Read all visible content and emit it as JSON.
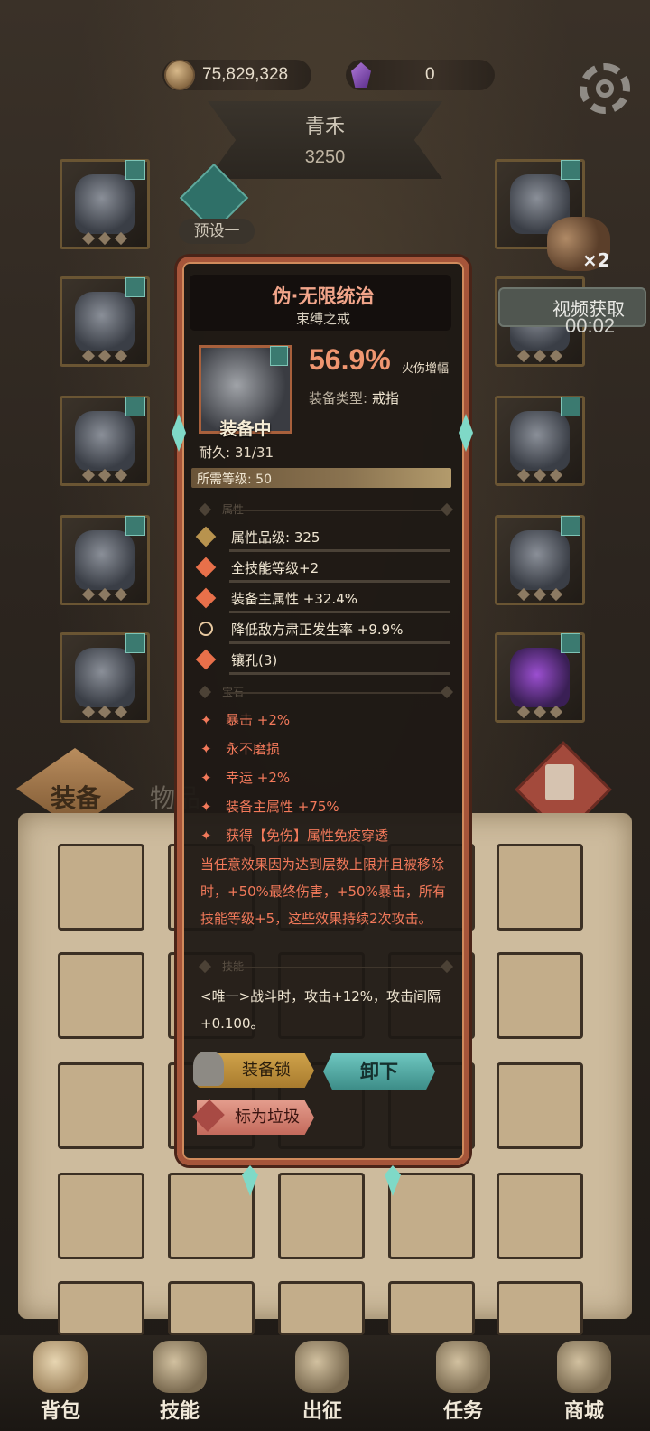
{
  "currency": {
    "coins": "75,829,328",
    "gems": "0"
  },
  "hero": {
    "name": "青禾",
    "power": "3250"
  },
  "preset": {
    "label": "预设一"
  },
  "reward": {
    "multiplier": "×2",
    "video_label": "视频获取",
    "timer": "00:02"
  },
  "tabs": {
    "equip": "装备",
    "items": "物品"
  },
  "tooltip": {
    "name": "伪·无限统治",
    "subtitle": "束缚之戒",
    "equipped_label": "装备中",
    "main_value": "56.9%",
    "main_value_label": "火伤增幅",
    "type_label": "装备类型:",
    "type_value": "戒指",
    "durability": "耐久: 31/31",
    "required_level": "所需等级: 50",
    "section_attributes": "属性",
    "attributes": [
      "属性品级: 325",
      "全技能等级+2",
      "装备主属性 +32.4%",
      "降低敌方肃正发生率 +9.9%",
      "镶孔(3)"
    ],
    "section_gems": "宝石",
    "gem_bonuses": [
      "暴击 +2%",
      "永不磨损",
      "幸运 +2%",
      "装备主属性 +75%",
      "获得【免伤】属性免疫穿透"
    ],
    "effect_text": "当任意效果因为达到层数上限并且被移除时，+50%最终伤害，+50%暴击，所有技能等级+5，这些效果持续2次攻击。",
    "section_skills": "技能",
    "skill_text": "<唯一>战斗时，攻击+12%，攻击间隔+0.100。",
    "btn_lock": "装备锁",
    "btn_unequip": "卸下",
    "btn_trash": "标为垃圾"
  },
  "bottom_nav": [
    {
      "label": "背包",
      "icon": "backpack-icon"
    },
    {
      "label": "技能",
      "icon": "skill-book-icon"
    },
    {
      "label": "出征",
      "icon": "sword-banner-icon"
    },
    {
      "label": "任务",
      "icon": "scroll-icon"
    },
    {
      "label": "商城",
      "icon": "shop-crown-icon"
    }
  ],
  "colors": {
    "accent_orange": "#f09670",
    "teal": "#6ec7c0",
    "red_text": "#f2795a"
  }
}
